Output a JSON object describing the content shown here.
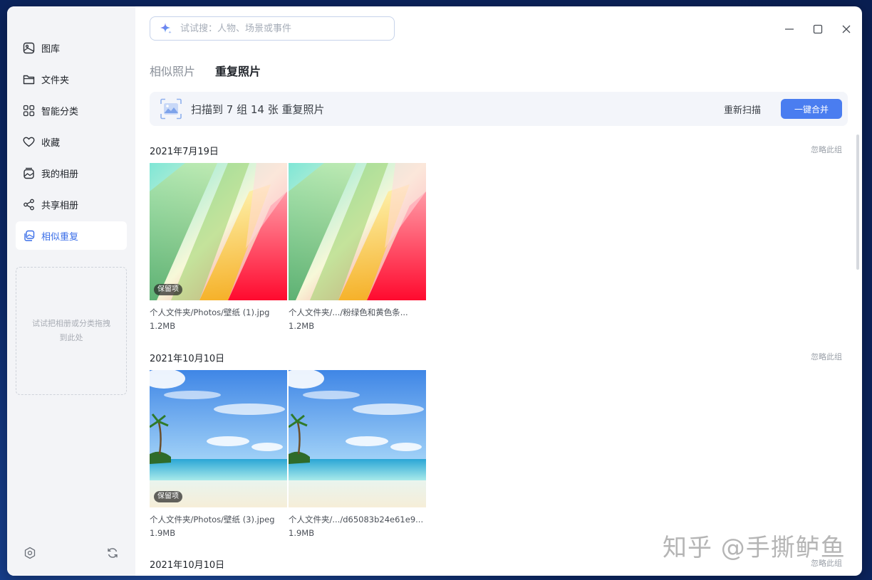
{
  "sidebar": {
    "items": [
      {
        "label": "图库",
        "icon": "gallery-icon"
      },
      {
        "label": "文件夹",
        "icon": "folder-icon"
      },
      {
        "label": "智能分类",
        "icon": "grid-icon"
      },
      {
        "label": "收藏",
        "icon": "heart-icon"
      },
      {
        "label": "我的相册",
        "icon": "album-icon"
      },
      {
        "label": "共享相册",
        "icon": "share-icon"
      },
      {
        "label": "相似重复",
        "icon": "duplicate-icon",
        "active": true
      }
    ],
    "drop_hint": "试试把相册或分类拖拽到此处"
  },
  "search": {
    "placeholder": "试试搜：人物、场景或事件"
  },
  "tabs": [
    {
      "label": "相似照片",
      "active": false
    },
    {
      "label": "重复照片",
      "active": true
    }
  ],
  "banner": {
    "text": "扫描到 7 组 14 张 重复照片",
    "rescan_label": "重新扫描",
    "merge_label": "一键合并"
  },
  "groups": [
    {
      "date": "2021年7月19日",
      "ignore_label": "忽略此组",
      "photos": [
        {
          "name": "个人文件夹/Photos/壁纸 (1).jpg",
          "size": "1.2MB",
          "badge": "保留项"
        },
        {
          "name": "个人文件夹/.../粉绿色和黄色条...",
          "size": "1.2MB"
        }
      ]
    },
    {
      "date": "2021年10月10日",
      "ignore_label": "忽略此组",
      "photos": [
        {
          "name": "个人文件夹/Photos/壁纸 (3).jpeg",
          "size": "1.9MB",
          "badge": "保留项"
        },
        {
          "name": "个人文件夹/.../d65083b24e61e9...",
          "size": "1.9MB"
        }
      ]
    },
    {
      "date": "2021年10月10日",
      "ignore_label": "忽略此组"
    }
  ],
  "watermark": "知乎 @手撕鲈鱼",
  "colors": {
    "accent": "#4a7df0",
    "active_text": "#3a6ee8"
  }
}
